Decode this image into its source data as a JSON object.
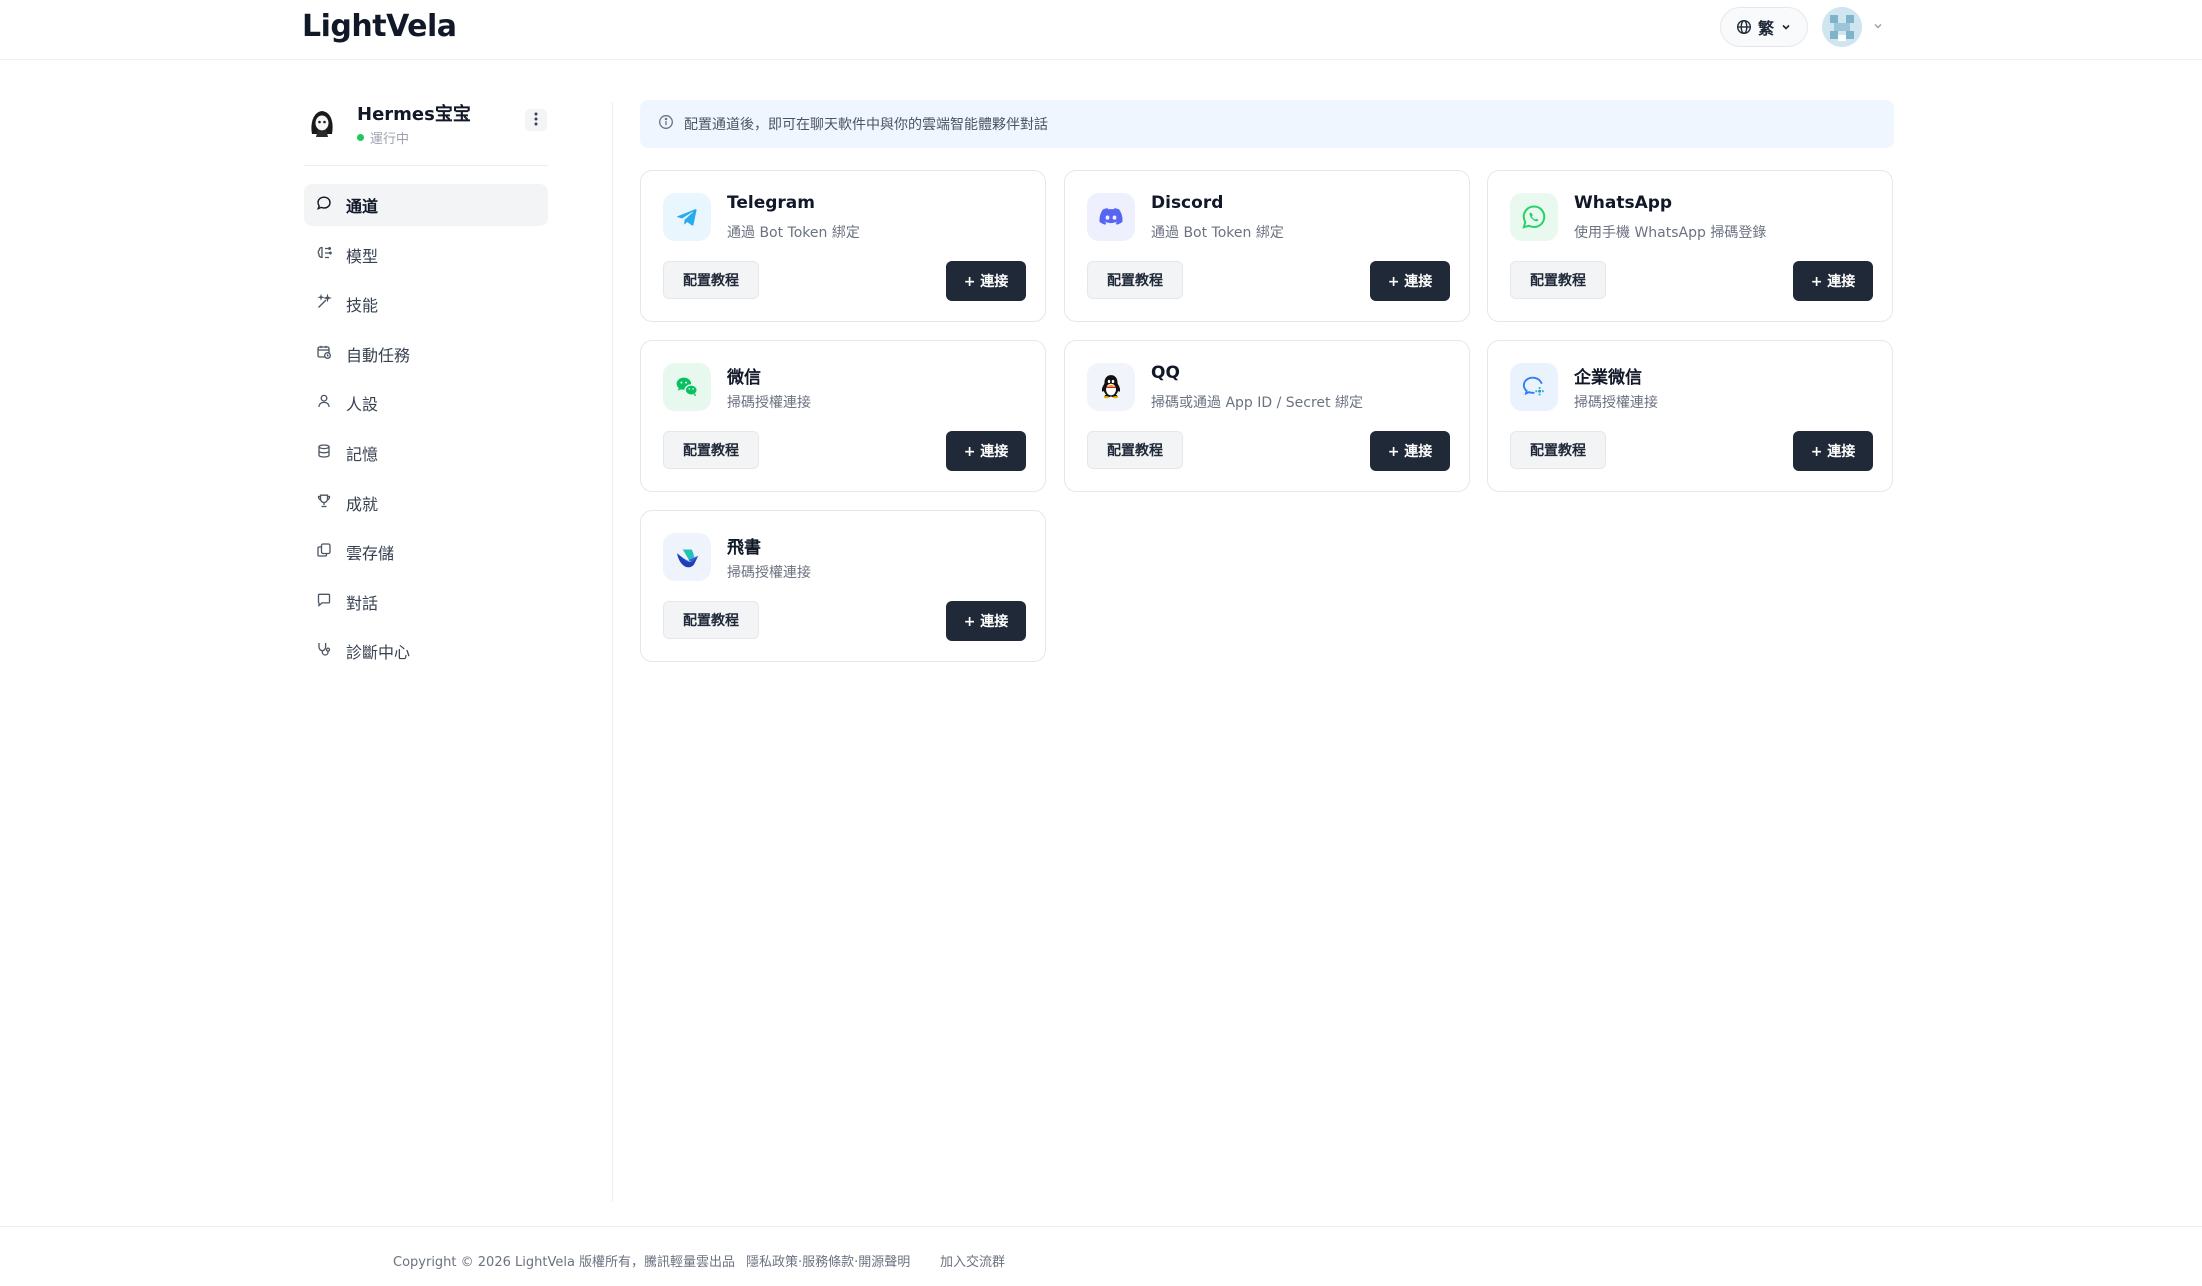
{
  "header": {
    "logo": "LightVela",
    "language_label": "繁",
    "icons": [
      "globe-icon",
      "chevron-down-icon",
      "user-avatar",
      "chevron-down-icon"
    ]
  },
  "agent": {
    "name": "Hermes宝宝",
    "status": "運行中",
    "status_color": "#22c55e"
  },
  "sidebar": {
    "items": [
      {
        "label": "通道",
        "icon": "chat-bubble-icon",
        "active": true
      },
      {
        "label": "模型",
        "icon": "brain-icon",
        "active": false
      },
      {
        "label": "技能",
        "icon": "magic-wand-icon",
        "active": false
      },
      {
        "label": "自動任務",
        "icon": "calendar-clock-icon",
        "active": false
      },
      {
        "label": "人設",
        "icon": "person-icon",
        "active": false
      },
      {
        "label": "記憶",
        "icon": "database-icon",
        "active": false
      },
      {
        "label": "成就",
        "icon": "trophy-icon",
        "active": false
      },
      {
        "label": "雲存儲",
        "icon": "copy-stack-icon",
        "active": false
      },
      {
        "label": "對話",
        "icon": "message-square-icon",
        "active": false
      },
      {
        "label": "診斷中心",
        "icon": "stethoscope-icon",
        "active": false
      }
    ]
  },
  "banner": {
    "text": "配置通道後，即可在聊天軟件中與你的雲端智能體夥伴對話"
  },
  "channels": [
    {
      "name": "Telegram",
      "desc": "通過 Bot Token 綁定",
      "icon": "telegram-icon",
      "guide": "配置教程",
      "connect": "+ 連接"
    },
    {
      "name": "Discord",
      "desc": "通過 Bot Token 綁定",
      "icon": "discord-icon",
      "guide": "配置教程",
      "connect": "+ 連接"
    },
    {
      "name": "WhatsApp",
      "desc": "使用手機 WhatsApp 掃碼登錄",
      "icon": "whatsapp-icon",
      "guide": "配置教程",
      "connect": "+ 連接"
    },
    {
      "name": "微信",
      "desc": "掃碼授權連接",
      "icon": "wechat-icon",
      "guide": "配置教程",
      "connect": "+ 連接"
    },
    {
      "name": "QQ",
      "desc": "掃碼或通過 App ID / Secret 綁定",
      "icon": "qq-icon",
      "guide": "配置教程",
      "connect": "+ 連接"
    },
    {
      "name": "企業微信",
      "desc": "掃碼授權連接",
      "icon": "wecom-icon",
      "guide": "配置教程",
      "connect": "+ 連接"
    },
    {
      "name": "飛書",
      "desc": "掃碼授權連接",
      "icon": "feishu-icon",
      "guide": "配置教程",
      "connect": "+ 連接"
    }
  ],
  "footer": {
    "copyright": "Copyright © 2026 LightVela 版權所有，騰訊輕量雲出品",
    "legal": "隱私政策·服務條款·開源聲明",
    "community": "加入交流群"
  },
  "colors": {
    "accent_dark": "#1f2937",
    "banner_bg": "#eff6ff",
    "telegram": "#2aabee",
    "discord": "#5865f2",
    "whatsapp": "#25d366",
    "wechat": "#07c160"
  }
}
